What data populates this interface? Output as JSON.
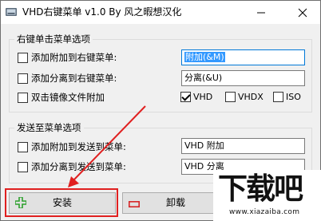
{
  "window": {
    "title": "VHD右键菜单 v1.0 By 风之暇想汉化",
    "icon": "vhd-app-icon",
    "minimize_icon": "minimize-icon",
    "close_icon": "close-icon"
  },
  "group_right_click": {
    "legend": "右键单击菜单选项",
    "rows": [
      {
        "label": "添加附加到右键菜单:",
        "checked": false,
        "value": "附加(&M)",
        "value_selected": true
      },
      {
        "label": "添加分离到右键菜单:",
        "checked": false,
        "value": "分离(&U)"
      },
      {
        "label": "双击镜像文件附加",
        "checked": false
      }
    ],
    "file_types": [
      {
        "label": "VHD",
        "checked": true
      },
      {
        "label": "VHDX",
        "checked": false
      },
      {
        "label": "ISO",
        "checked": false
      }
    ]
  },
  "group_send_to": {
    "legend": "发送至菜单选项",
    "rows": [
      {
        "label": "添加附加到发送到菜单:",
        "checked": false,
        "value": "VHD 附加"
      },
      {
        "label": "添加分离到发送到菜单:",
        "checked": false,
        "value": "VHD 分离"
      }
    ]
  },
  "buttons": {
    "install": "安装",
    "uninstall": "卸载",
    "install_icon": "plus-icon",
    "uninstall_icon": "minus-icon"
  },
  "colors": {
    "highlight": "#e02020",
    "plus_icon": "#2ca02c",
    "minus_icon": "#d62728",
    "selection": "#3399ff",
    "focus_border": "#0078d7"
  },
  "watermark": {
    "logo": "下载吧",
    "url": "www.xiazaiba.com"
  }
}
